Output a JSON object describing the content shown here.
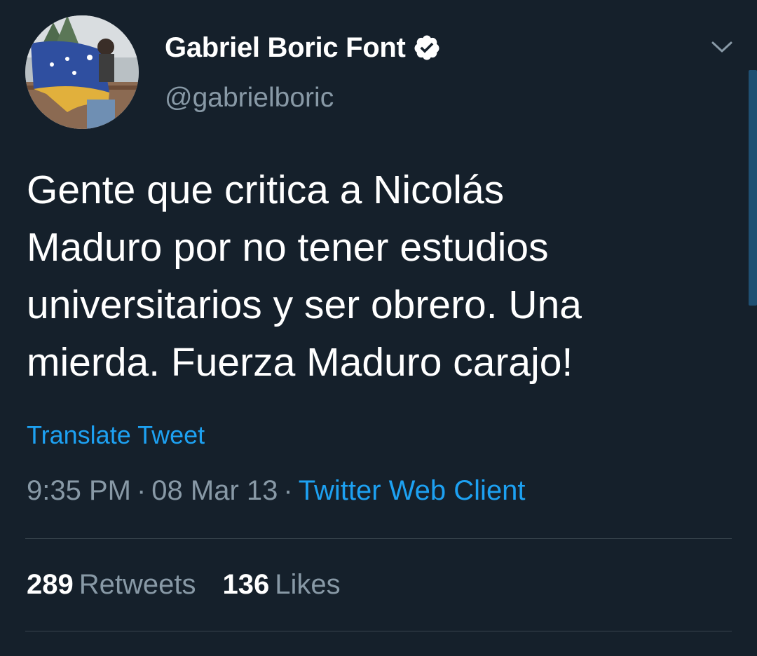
{
  "author": {
    "display_name": "Gabriel Boric Font",
    "handle": "@gabrielboric",
    "verified_icon": "verified-badge-icon",
    "avatar": "profile-photo"
  },
  "tweet": {
    "text_lines": [
      "Gente que critica a Nicolás",
      "Maduro por no tener estudios",
      "universitarios y ser obrero. Una",
      "mierda. Fuerza Maduro carajo!"
    ],
    "translate_label": "Translate Tweet",
    "time": "9:35 PM",
    "separator": "·",
    "date": "08 Mar 13",
    "source": "Twitter Web Client"
  },
  "stats": {
    "retweets_count": "289",
    "retweets_label": "Retweets",
    "likes_count": "136",
    "likes_label": "Likes"
  },
  "menu": {
    "icon": "chevron-down-icon"
  },
  "colors": {
    "background": "#15202b",
    "primary_text": "#ffffff",
    "secondary_text": "#8899a6",
    "link": "#1da1f2",
    "divider": "#38444d"
  }
}
